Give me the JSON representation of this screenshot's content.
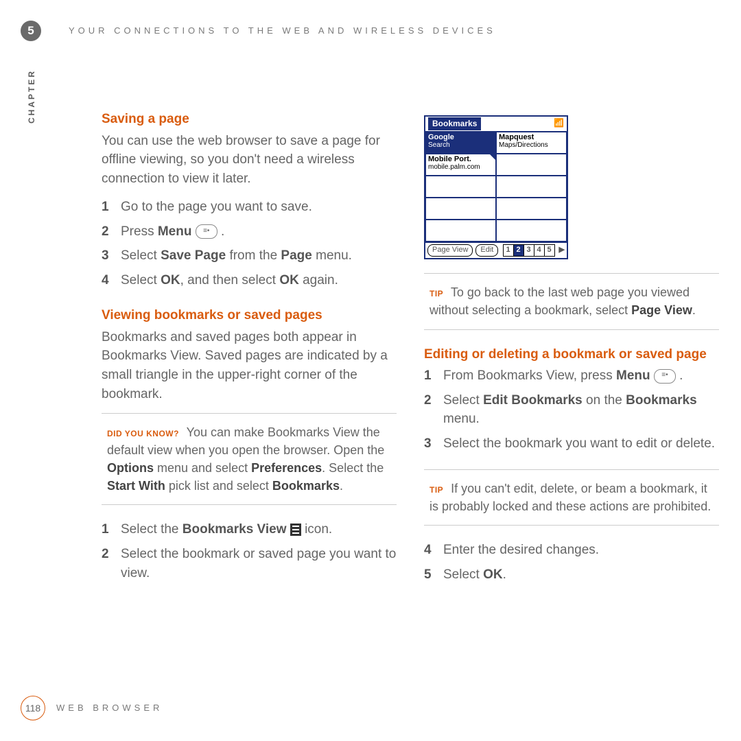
{
  "chapter": {
    "num": "5",
    "label": "CHAPTER"
  },
  "header": "YOUR CONNECTIONS TO THE WEB AND WIRELESS DEVICES",
  "footer": {
    "page": "118",
    "text": "WEB BROWSER"
  },
  "sec1": {
    "title": "Saving a page",
    "intro": "You can use the web browser to save a page for offline viewing, so you don't need a wireless connection to view it later.",
    "s1": "Go to the page you want to save.",
    "s2a": "Press ",
    "s2b": "Menu",
    "s2c": " .",
    "s3a": "Select ",
    "s3b": "Save Page",
    "s3c": " from the ",
    "s3d": "Page",
    "s3e": " menu.",
    "s4a": "Select ",
    "s4b": "OK",
    "s4c": ", and then select ",
    "s4d": "OK",
    "s4e": " again."
  },
  "sec2": {
    "title": "Viewing bookmarks or saved pages",
    "intro": "Bookmarks and saved pages both appear in Bookmarks View. Saved pages are indicated by a small triangle in the upper-right corner of the bookmark."
  },
  "dyk": {
    "label": "DID YOU KNOW?",
    "a": " You can make Bookmarks View the default view when you open the browser. Open the ",
    "b": "Options",
    "c": " menu and select ",
    "d": "Preferences",
    "e": ". Select the ",
    "f": "Start With",
    "g": " pick list and select ",
    "h": "Bookmarks",
    "i": "."
  },
  "sec2steps": {
    "s1a": "Select the ",
    "s1b": "Bookmarks View",
    "s1c": " icon.",
    "s2": "Select the bookmark or saved page you want to view."
  },
  "shot": {
    "title": "Bookmarks",
    "c1a": "Google",
    "c1b": "Search",
    "c2a": "Mapquest",
    "c2b": "Maps/Directions",
    "c3a": "Mobile Port.",
    "c3b": "mobile.palm.com",
    "btn1": "Page View",
    "btn2": "Edit",
    "p1": "1",
    "p2": "2",
    "p3": "3",
    "p4": "4",
    "p5": "5"
  },
  "tip1": {
    "label": "TIP",
    "a": " To go back to the last web page you viewed without selecting a bookmark, select ",
    "b": "Page View",
    "c": "."
  },
  "sec3": {
    "title": "Editing or deleting a bookmark or saved page",
    "s1a": "From Bookmarks View, press ",
    "s1b": "Menu",
    "s1c": " .",
    "s2a": "Select ",
    "s2b": "Edit Bookmarks",
    "s2c": " on the ",
    "s2d": "Bookmarks",
    "s2e": " menu.",
    "s3": "Select the bookmark you want to edit or delete.",
    "s4": "Enter the desired changes.",
    "s5a": "Select ",
    "s5b": "OK",
    "s5c": "."
  },
  "tip2": {
    "label": "TIP",
    "a": " If you can't edit, delete, or beam a bookmark, it is probably locked and these actions are prohibited."
  }
}
